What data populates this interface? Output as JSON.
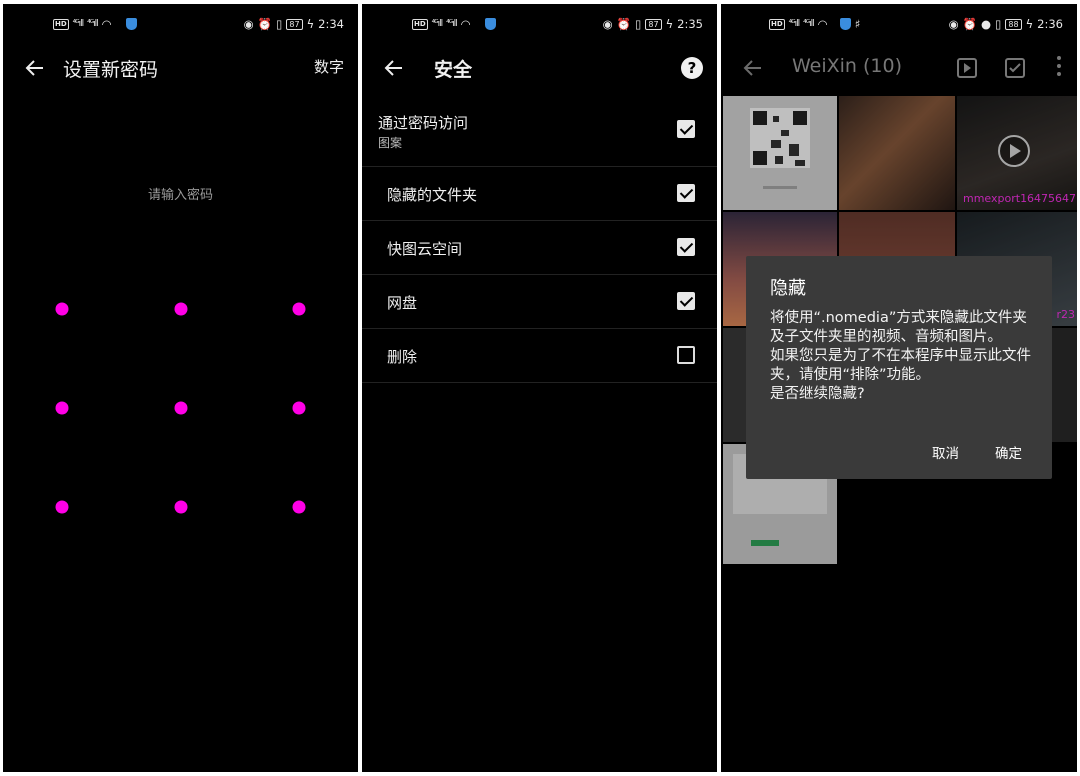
{
  "panel1": {
    "status": {
      "time": "2:34",
      "battery": "87"
    },
    "title": "设置新密码",
    "action_label": "数字",
    "hint": "请输入密码",
    "pattern_dot_color": "#ff00e6"
  },
  "panel2": {
    "status": {
      "time": "2:35",
      "battery": "87"
    },
    "title": "安全",
    "help_glyph": "?",
    "header_item": {
      "title": "通过密码访问",
      "subtitle": "图案",
      "checked": true
    },
    "items": [
      {
        "label": "隐藏的文件夹",
        "checked": true
      },
      {
        "label": "快图云空间",
        "checked": true
      },
      {
        "label": "网盘",
        "checked": true
      },
      {
        "label": "删除",
        "checked": false
      }
    ]
  },
  "panel3": {
    "status": {
      "time": "2:36",
      "battery": "88"
    },
    "title": "WeiXin (10)",
    "thumb_caption": "mmexport16475647",
    "thumb_caption_2": "r23",
    "dialog": {
      "title": "隐藏",
      "message": "将使用“.nomedia”方式来隐藏此文件夹及子文件夹里的视频、音频和图片。\n如果您只是为了不在本程序中显示此文件夹，请使用“排除”功能。\n是否继续隐藏?",
      "cancel_label": "取消",
      "ok_label": "确定"
    }
  }
}
